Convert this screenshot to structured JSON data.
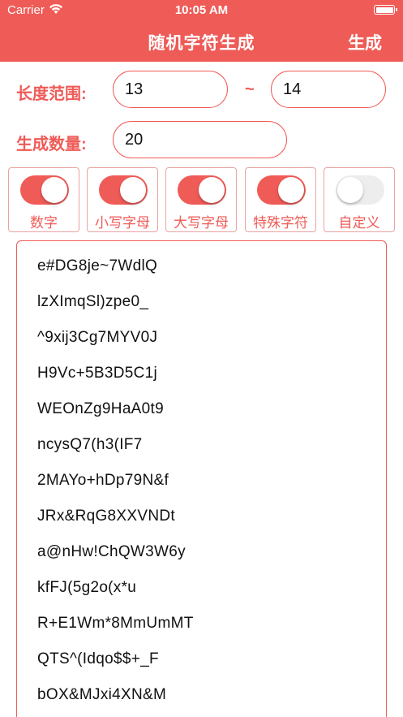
{
  "status": {
    "carrier": "Carrier",
    "time": "10:05 AM"
  },
  "nav": {
    "title": "随机字符生成",
    "generate_label": "生成"
  },
  "length": {
    "label": "长度范围:",
    "min": "13",
    "separator": "~",
    "max": "14"
  },
  "count": {
    "label": "生成数量:",
    "value": "20"
  },
  "options": [
    {
      "label": "数字",
      "on": true
    },
    {
      "label": "小写字母",
      "on": true
    },
    {
      "label": "大写字母",
      "on": true
    },
    {
      "label": "特殊字符",
      "on": true
    },
    {
      "label": "自定义",
      "on": false
    }
  ],
  "results": [
    "e#DG8je~7WdlQ",
    "lzXImqSl)zpe0_",
    "^9xij3Cg7MYV0J",
    "H9Vc+5B3D5C1j",
    "WEOnZg9HaA0t9",
    "ncysQ7(h3(IF7",
    "2MAYo+hDp79N&f",
    "JRx&RqG8XXVNDt",
    "a@nHw!ChQW3W6y",
    "kfFJ(5g2o(x*u",
    "R+E1Wm*8MmUmMT",
    "QTS^(Idqo$$+_F",
    "bOX&MJxi4XN&M"
  ],
  "colors": {
    "accent": "#ef5b57",
    "toggle_off": "#ededed"
  }
}
